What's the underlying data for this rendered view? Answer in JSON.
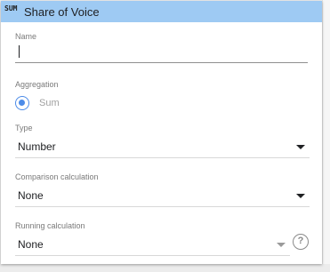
{
  "header": {
    "icon_text": "SUM",
    "title": "Share of Voice"
  },
  "name_field": {
    "label": "Name",
    "value": ""
  },
  "aggregation": {
    "label": "Aggregation",
    "selected_option": "Sum"
  },
  "type_field": {
    "label": "Type",
    "value": "Number"
  },
  "comparison": {
    "label": "Comparison calculation",
    "value": "None"
  },
  "running": {
    "label": "Running calculation",
    "value": "None",
    "help_icon_text": "?"
  },
  "colors": {
    "header_bg": "#9ecaf3",
    "accent": "#4c8be8"
  }
}
